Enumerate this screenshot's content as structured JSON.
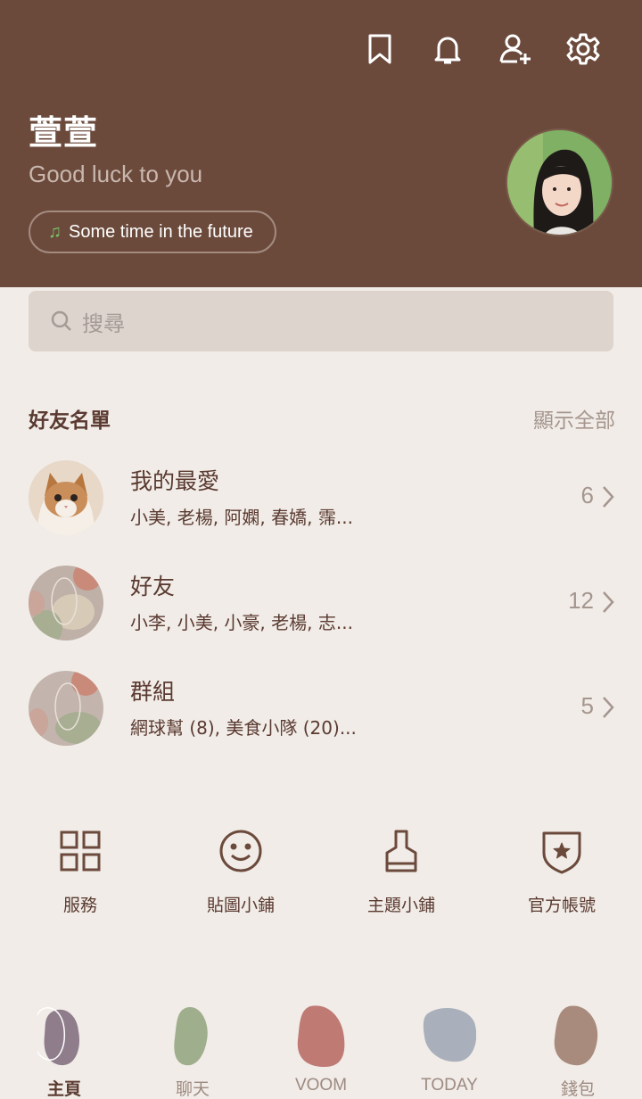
{
  "header": {
    "name": "萱萱",
    "status": "Good luck to you",
    "music": "Some time in the future",
    "icons": [
      "bookmark-icon",
      "bell-icon",
      "add-friend-icon",
      "settings-icon"
    ]
  },
  "search": {
    "placeholder": "搜尋"
  },
  "friends": {
    "title": "好友名單",
    "show_all": "顯示全部",
    "rows": [
      {
        "title": "我的最愛",
        "members": "小美, 老楊, 阿嫻, 春嬌, 霈...",
        "count": "6"
      },
      {
        "title": "好友",
        "members": "小李, 小美, 小豪, 老楊, 志...",
        "count": "12"
      },
      {
        "title": "群組",
        "members": "網球幫 (8), 美食小隊 (20)...",
        "count": "5"
      }
    ]
  },
  "quick_menu": [
    {
      "label": "服務",
      "icon": "grid-icon"
    },
    {
      "label": "貼圖小鋪",
      "icon": "smiley-icon"
    },
    {
      "label": "主題小鋪",
      "icon": "brush-icon"
    },
    {
      "label": "官方帳號",
      "icon": "shield-star-icon"
    }
  ],
  "bottom_nav": [
    {
      "label": "主頁",
      "color": "#8f7d8c",
      "active": true
    },
    {
      "label": "聊天",
      "color": "#9fae8c",
      "active": false
    },
    {
      "label": "VOOM",
      "color": "#c07a74",
      "active": false
    },
    {
      "label": "TODAY",
      "color": "#a9b0bb",
      "active": false
    },
    {
      "label": "錢包",
      "color": "#a98b7d",
      "active": false
    }
  ],
  "colors": {
    "header": "#6b4a3c",
    "background": "#f1ece7",
    "text": "#5a3a31"
  }
}
